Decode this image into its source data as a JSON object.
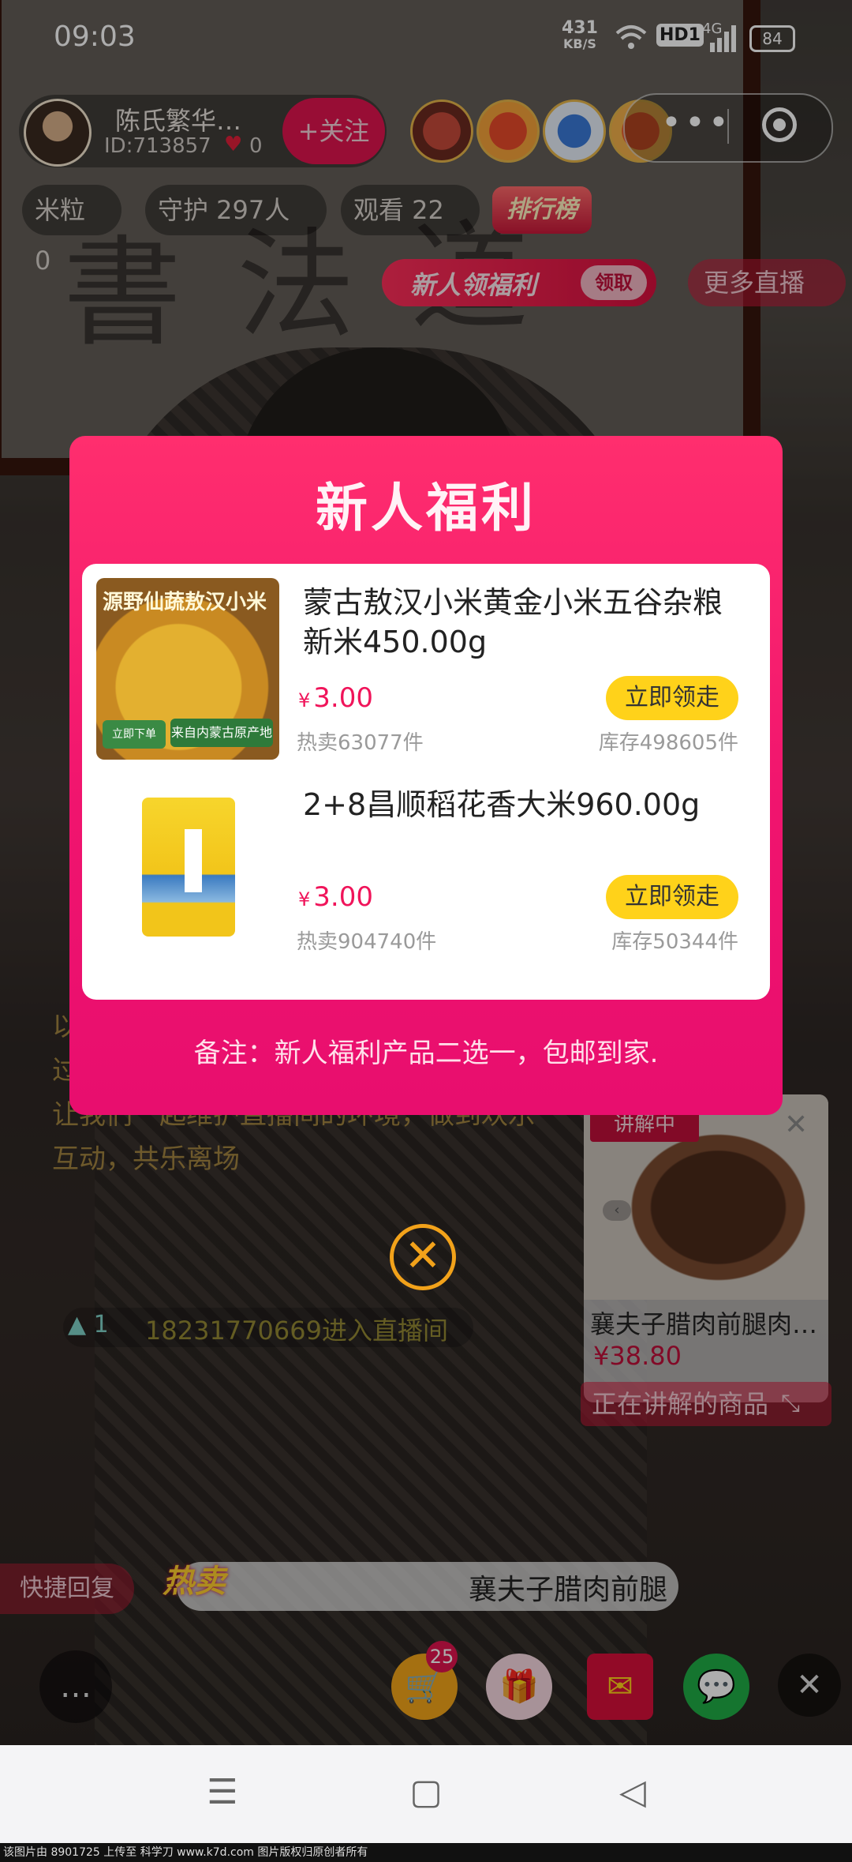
{
  "status_bar": {
    "time": "09:03",
    "net_speed": "431",
    "net_unit": "KB/S",
    "hd": "HD1",
    "network": "4G",
    "battery": "84"
  },
  "anchor": {
    "name": "陈氏繁华…",
    "id": "ID:713857",
    "likes": "0",
    "follow_label": "+关注"
  },
  "stats": {
    "rice": "米粒 0",
    "guard": "守护 297人",
    "viewers": "观看 22",
    "rank_badge": "排行榜"
  },
  "welfare_banner": {
    "text": "新人领福利",
    "claim": "领取"
  },
  "more_live": "更多直播",
  "chat": {
    "message": "以文明的方式进行互动，直播间禁止出现过激言论，益米播团队会进行24小时监督.让我们一起维护直播间的环境，做到欢乐互动，共乐离场",
    "level": "1",
    "enter": "18231770669进入直播间"
  },
  "live_product": {
    "tag": "讲解中",
    "title": "襄夫子腊肉前腿肉…",
    "price": "¥38.80",
    "footer": "正在讲解的商品"
  },
  "modal": {
    "title": "新人福利",
    "products": [
      {
        "name": "蒙古敖汉小米黄金小米五谷杂粮新米450.00g",
        "image_text": "源野仙蔬敖汉小米",
        "image_sub": "来自内蒙古原产地",
        "image_green": "立即下单",
        "currency": "¥",
        "price": "3.00",
        "sold": "热卖63077件",
        "stock": "库存498605件",
        "claim": "立即领走"
      },
      {
        "name": "2+8昌顺稻花香大米960.00g",
        "currency": "¥",
        "price": "3.00",
        "sold": "热卖904740件",
        "stock": "库存50344件",
        "claim": "立即领走"
      }
    ],
    "note": "备注：新人福利产品二选一，包邮到家."
  },
  "bottom": {
    "quick_reply": "快捷回复",
    "hot_badge": "热卖",
    "hot_text": "襄夫子腊肉前腿",
    "cart_count": "25"
  },
  "watermark": "该图片由 8901725 上传至 科学刀 www.k7d.com 图片版权归原创者所有"
}
